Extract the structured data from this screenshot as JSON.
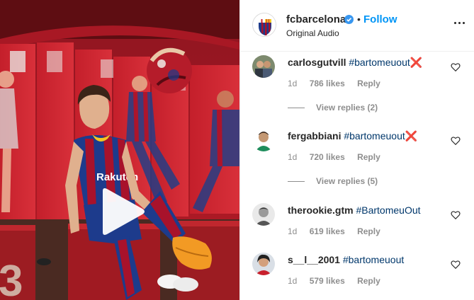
{
  "post": {
    "account": "fcbarcelona",
    "separator": "•",
    "follow_label": "Follow",
    "audio": "Original Audio",
    "player_shirt_sponsor": "Rakuten",
    "poster_shirt_text": "Rakuten"
  },
  "comments": [
    {
      "user": "carlosgutvill",
      "text": "#bartomeuout",
      "flag": "❌",
      "age": "1d",
      "likes": "786 likes",
      "reply": "Reply",
      "view_replies": "View replies (2)"
    },
    {
      "user": "fergabbiani",
      "text": "#bartomeuout",
      "flag": "❌",
      "age": "1d",
      "likes": "720 likes",
      "reply": "Reply",
      "view_replies": "View replies (5)"
    },
    {
      "user": "therookie.gtm",
      "text": "#BartomeuOut",
      "flag": "",
      "age": "1d",
      "likes": "619 likes",
      "reply": "Reply",
      "view_replies": ""
    },
    {
      "user": "s__l__2001",
      "text": "#bartomeuout",
      "flag": "",
      "age": "1d",
      "likes": "579 likes",
      "reply": "Reply",
      "view_replies": ""
    }
  ],
  "icons": {
    "play": "play-icon",
    "verified": "verified-badge-icon",
    "more": "more-options-icon",
    "heart": "heart-outline-icon"
  },
  "colors": {
    "follow": "#0095f6",
    "hashtag": "#00376b",
    "muted": "#8e8e8e",
    "locker_red": "#c8202c",
    "cross_red": "#e0245e"
  }
}
